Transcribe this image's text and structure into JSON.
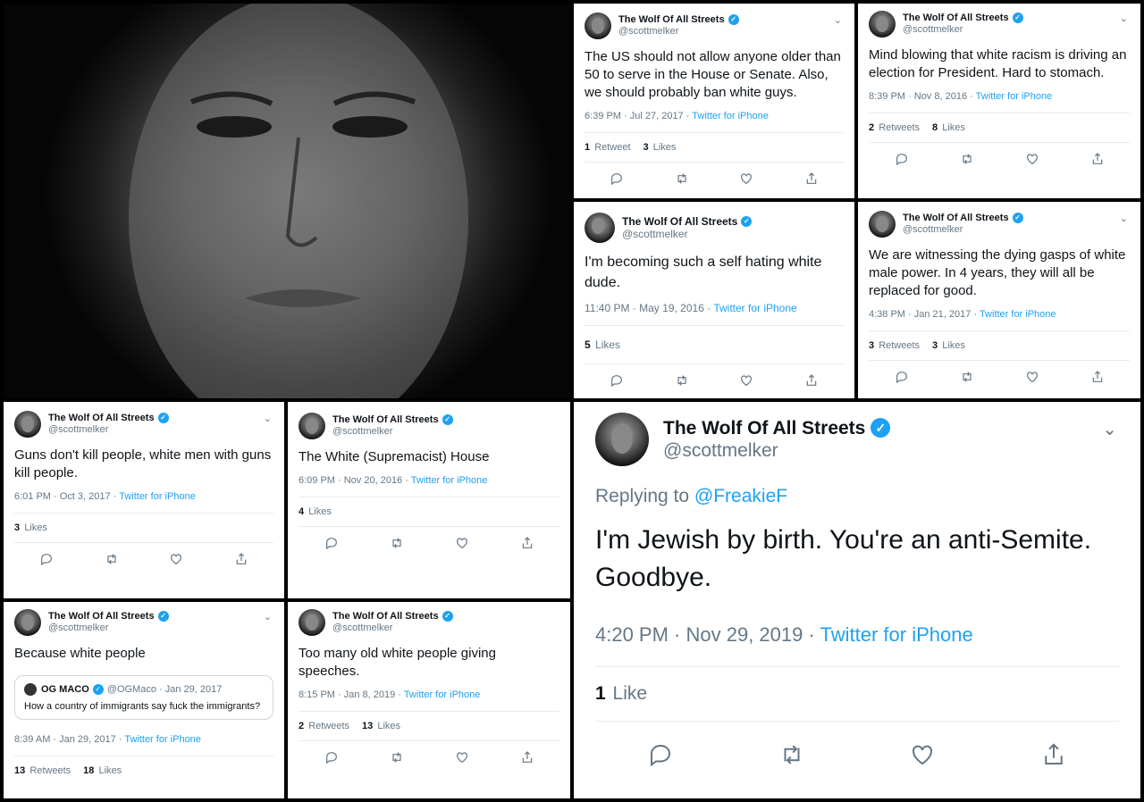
{
  "colors": {
    "link": "#1da1f2",
    "muted": "#657786",
    "verified": "#1da1f2"
  },
  "photo": {
    "icon": "portrait-photo"
  },
  "tweets": [
    {
      "name": "The Wolf Of All Streets",
      "handle": "@scottmelker",
      "text": "The US should not allow anyone older than 50 to serve in the House or Senate. Also, we should probably ban white guys.",
      "time": "6:39 PM · Jul 27, 2017",
      "source": "Twitter for iPhone",
      "retweets_n": "1",
      "retweets_l": "Retweet",
      "likes_n": "3",
      "likes_l": "Likes"
    },
    {
      "name": "The Wolf Of All Streets",
      "handle": "@scottmelker",
      "text": "Mind blowing that white racism is driving an election for President. Hard to stomach.",
      "time": "8:39 PM · Nov 8, 2016",
      "source": "Twitter for iPhone",
      "retweets_n": "2",
      "retweets_l": "Retweets",
      "likes_n": "8",
      "likes_l": "Likes"
    },
    {
      "name": "The Wolf Of All Streets",
      "handle": "@scottmelker",
      "text": "I'm becoming such a self hating white dude.",
      "time": "11:40 PM · May 19, 2016",
      "source": "Twitter for iPhone",
      "likes_n": "5",
      "likes_l": "Likes"
    },
    {
      "name": "The Wolf Of All Streets",
      "handle": "@scottmelker",
      "text": "We are witnessing the dying gasps of white male power. In 4 years, they will all be replaced for good.",
      "time": "4:38 PM · Jan 21, 2017",
      "source": "Twitter for iPhone",
      "retweets_n": "3",
      "retweets_l": "Retweets",
      "likes_n": "3",
      "likes_l": "Likes"
    },
    {
      "name": "The Wolf Of All Streets",
      "handle": "@scottmelker",
      "text": "Guns don't kill people, white men with guns kill people.",
      "time": "6:01 PM · Oct 3, 2017",
      "source": "Twitter for iPhone",
      "likes_n": "3",
      "likes_l": "Likes"
    },
    {
      "name": "The Wolf Of All Streets",
      "handle": "@scottmelker",
      "text": "The White (Supremacist) House",
      "time": "6:09 PM · Nov 20, 2016",
      "source": "Twitter for iPhone",
      "likes_n": "4",
      "likes_l": "Likes"
    },
    {
      "name": "The Wolf Of All Streets",
      "handle": "@scottmelker",
      "text": "Because white people",
      "quote": {
        "name": "OG MACO",
        "handle": "@OGMaco",
        "date": "· Jan 29, 2017",
        "text": "How a country of immigrants say fuck the immigrants?"
      },
      "time": "8:39 AM · Jan 29, 2017",
      "source": "Twitter for iPhone",
      "retweets_n": "13",
      "retweets_l": "Retweets",
      "likes_n": "18",
      "likes_l": "Likes"
    },
    {
      "name": "The Wolf Of All Streets",
      "handle": "@scottmelker",
      "text": "Too many old white people giving speeches.",
      "time": "8:15 PM · Jan 8, 2019",
      "source": "Twitter for iPhone",
      "retweets_n": "2",
      "retweets_l": "Retweets",
      "likes_n": "13",
      "likes_l": "Likes"
    },
    {
      "name": "The Wolf Of All Streets",
      "handle": "@scottmelker",
      "reply_prefix": "Replying to",
      "reply_to": "@FreakieF",
      "text": "I'm Jewish by birth. You're an anti-Semite. Goodbye.",
      "time": "4:20 PM · Nov 29, 2019",
      "source": "Twitter for iPhone",
      "likes_n": "1",
      "likes_l": "Like"
    }
  ]
}
